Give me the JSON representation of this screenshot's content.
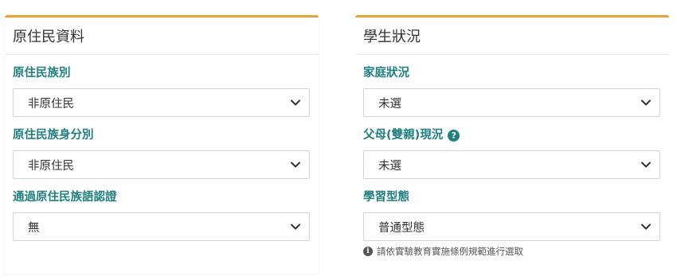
{
  "colors": {
    "accent": "#f0a030",
    "label": "#1e7f7f",
    "border": "#cfd4d9"
  },
  "left_panel": {
    "title": "原住民資料",
    "fields": [
      {
        "label": "原住民族別",
        "value": "非原住民"
      },
      {
        "label": "原住民族身分別",
        "value": "非原住民"
      },
      {
        "label": "通過原住民族語認證",
        "value": "無"
      }
    ]
  },
  "right_panel": {
    "title": "學生狀況",
    "fields": [
      {
        "label": "家庭狀況",
        "value": "未選"
      },
      {
        "label": "父母(雙親)現況",
        "value": "未選",
        "help_icon": "?"
      },
      {
        "label": "學習型態",
        "value": "普通型態",
        "hint": "請依實驗教育實施條例規範進行選取",
        "hint_icon": "i"
      }
    ]
  },
  "icons": {
    "select_arrow": "chevron-down-icon",
    "help": "question-circle-icon",
    "info": "info-circle-icon"
  }
}
